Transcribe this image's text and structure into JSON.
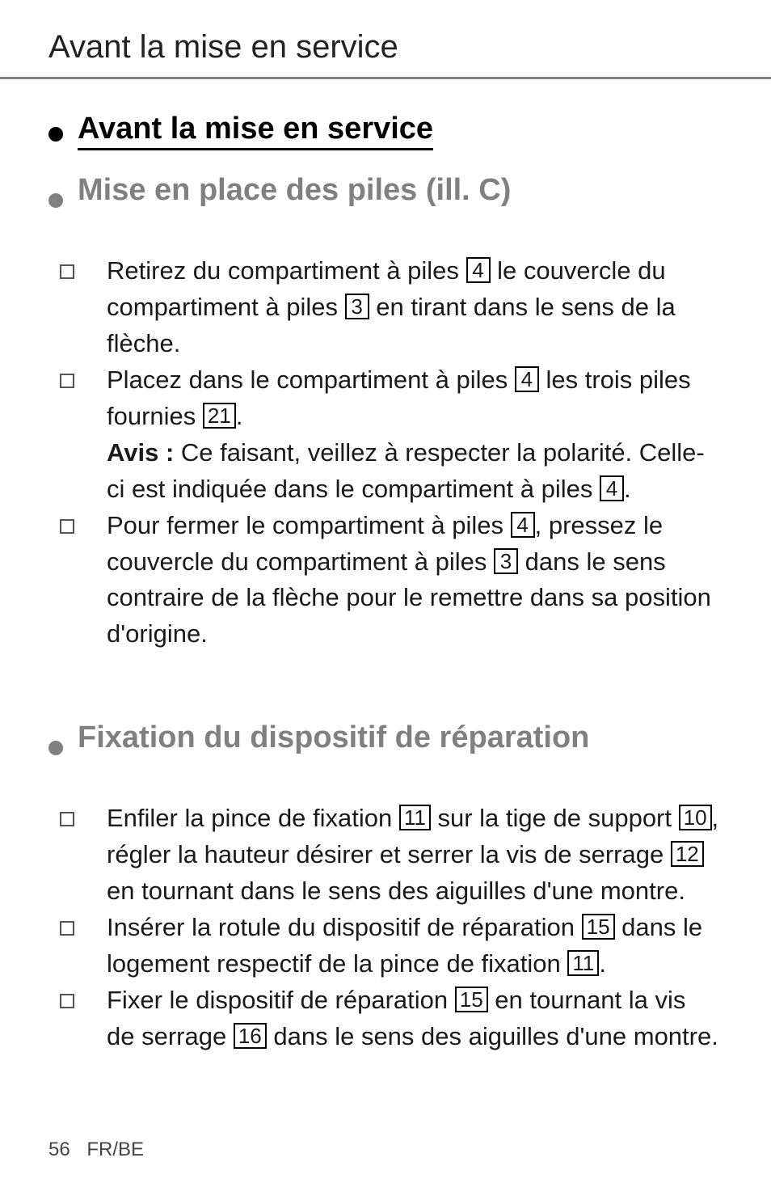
{
  "header": {
    "running_title": "Avant la mise en service"
  },
  "section1": {
    "heading": "Avant la mise en service"
  },
  "section2": {
    "heading": "Mise en place des piles (ill. C)",
    "items": {
      "i1": {
        "t1": "Retirez du compartiment à piles ",
        "r1": "4",
        "t2": " le couvercle du compartiment à piles ",
        "r2": "3",
        "t3": " en tirant dans le sens de la flèche."
      },
      "i2": {
        "t1": "Placez dans le compartiment à piles ",
        "r1": "4",
        "t2": " les trois piles fournies ",
        "r2": "21",
        "t3": ".",
        "noteLabel": "Avis :",
        "noteText1": " Ce faisant, veillez à respecter la polarité. Celle-ci est indiquée dans le compartiment à piles ",
        "noteRef": "4",
        "noteText2": "."
      },
      "i3": {
        "t1": "Pour fermer le compartiment à piles ",
        "r1": "4",
        "t2": ", pressez le couvercle du compartiment à piles ",
        "r2": "3",
        "t3": " dans le sens contraire de la flèche pour le remettre dans sa position d'origine."
      }
    }
  },
  "section3": {
    "heading": "Fixation du dispositif de réparation",
    "items": {
      "i1": {
        "t1": "Enfiler la pince de fixation ",
        "r1": "11",
        "t2": " sur la tige de support ",
        "r2": "10",
        "t3": ", régler la hauteur désirer et serrer la vis de serrage ",
        "r3": "12",
        "t4": " en tournant dans le sens des aiguilles d'une montre."
      },
      "i2": {
        "t1": "Insérer la rotule du dispositif de réparation ",
        "r1": "15",
        "t2": " dans le logement respectif de la pince de fixation ",
        "r2": "11",
        "t3": "."
      },
      "i3": {
        "t1": "Fixer le dispositif de réparation ",
        "r1": "15",
        "t2": " en tournant la vis de serrage ",
        "r2": "16",
        "t3": " dans le sens des aiguilles d'une montre."
      }
    }
  },
  "footer": {
    "page": "56",
    "lang": "FR/BE"
  }
}
